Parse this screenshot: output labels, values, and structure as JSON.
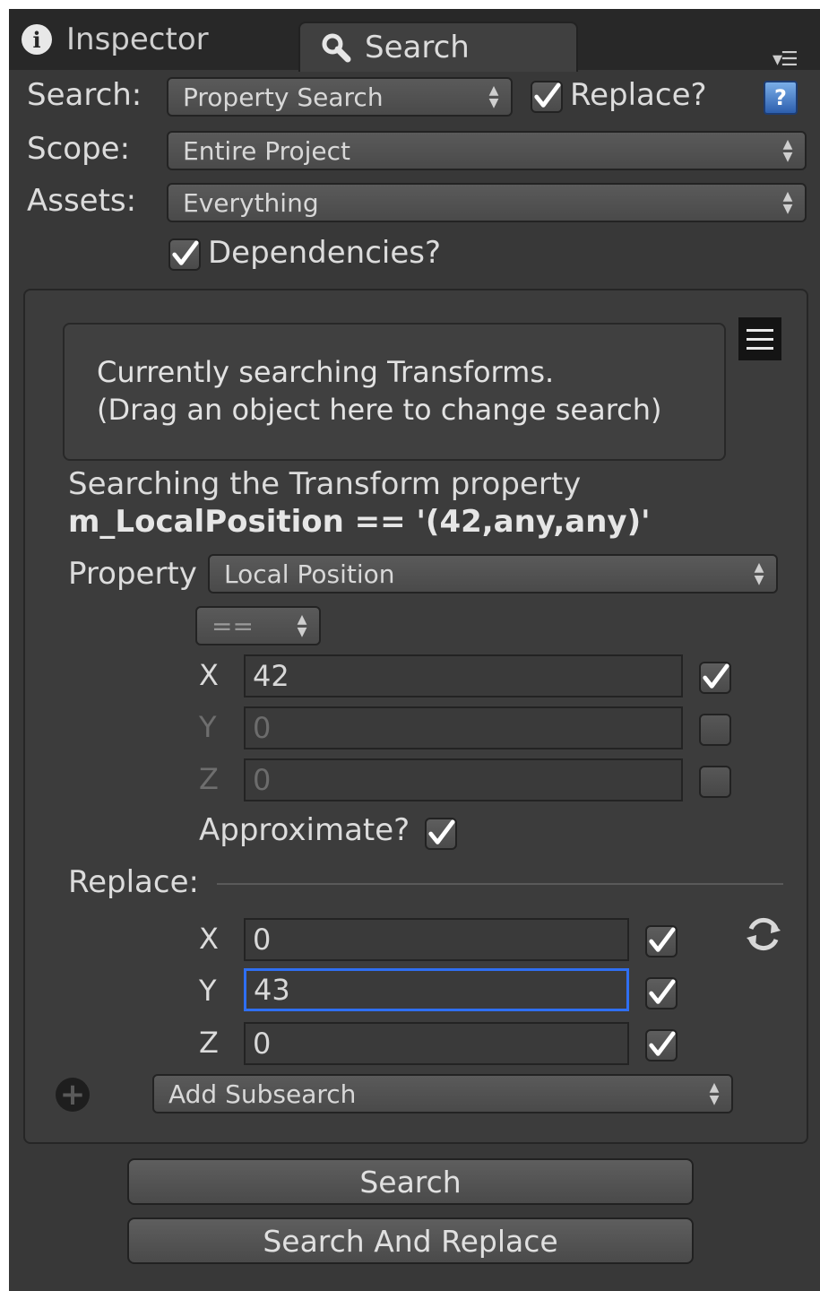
{
  "tabs": [
    {
      "label": "Inspector",
      "icon": "info-icon"
    },
    {
      "label": "Search",
      "icon": "magnifier-icon",
      "active": true
    }
  ],
  "search_row": {
    "label": "Search:",
    "dropdown": "Property Search",
    "replace_checked": true,
    "replace_label": "Replace?"
  },
  "scope_row": {
    "label": "Scope:",
    "dropdown": "Entire Project"
  },
  "assets_row": {
    "label": "Assets:",
    "dropdown": "Everything"
  },
  "dependencies": {
    "checked": true,
    "label": "Dependencies?"
  },
  "help_icon_text": "?",
  "dropzone": {
    "line1": "Currently searching Transforms.",
    "line2": "(Drag an object here to change search)"
  },
  "description": {
    "line1": "Searching the Transform property",
    "line2": "m_LocalPosition == '(42,any,any)'"
  },
  "property": {
    "label": "Property",
    "dropdown": "Local Position"
  },
  "operator": "==",
  "search_values": [
    {
      "axis": "X",
      "value": "42",
      "checked": true,
      "enabled": true
    },
    {
      "axis": "Y",
      "value": "0",
      "checked": false,
      "enabled": false
    },
    {
      "axis": "Z",
      "value": "0",
      "checked": false,
      "enabled": false
    }
  ],
  "approximate": {
    "label": "Approximate?",
    "checked": true
  },
  "replace": {
    "label": "Replace:",
    "values": [
      {
        "axis": "X",
        "value": "0",
        "checked": true
      },
      {
        "axis": "Y",
        "value": "43",
        "checked": true,
        "focused": true
      },
      {
        "axis": "Z",
        "value": "0",
        "checked": true
      }
    ]
  },
  "add_subsearch": "Add Subsearch",
  "buttons": {
    "search": "Search",
    "search_and_replace": "Search And Replace"
  },
  "colors": {
    "panel_bg": "#383838",
    "focus_border": "#2f6ff2",
    "check_mark": "#ffffff"
  }
}
